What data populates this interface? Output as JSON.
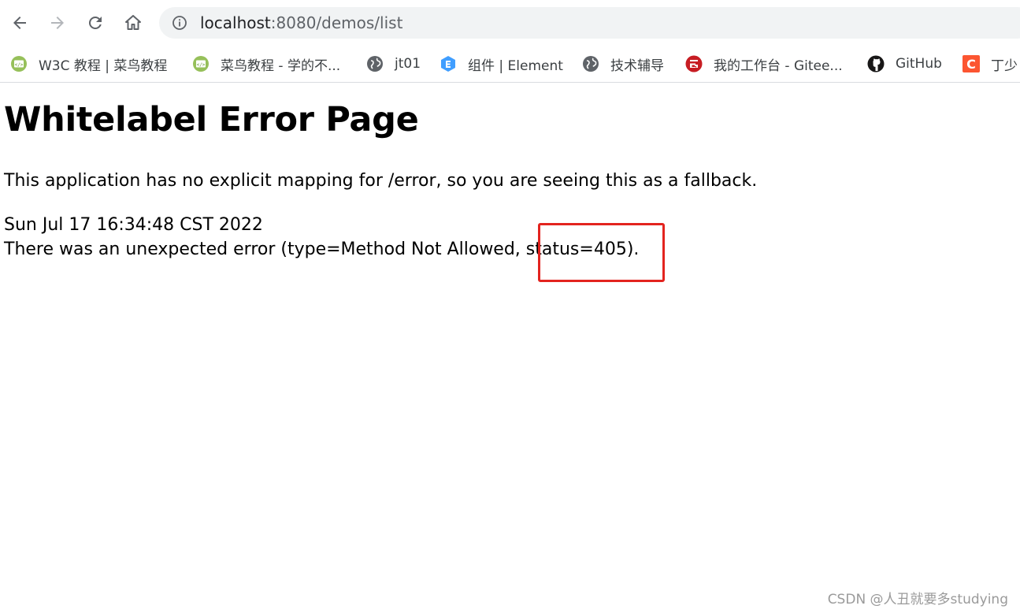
{
  "browser": {
    "address_bar": {
      "host": "localhost",
      "rest": ":8080/demos/list"
    },
    "icons": {
      "back": "arrow-left-icon",
      "forward": "arrow-right-icon",
      "reload": "reload-icon",
      "home": "home-icon",
      "site_info": "info-circle-icon"
    },
    "bookmarks": [
      {
        "label": "W3C 教程 | 菜鸟教程",
        "icon": "runoob-icon"
      },
      {
        "label": "菜鸟教程 - 学的不...",
        "icon": "runoob-icon"
      },
      {
        "label": "jt01",
        "icon": "globe-icon"
      },
      {
        "label": "组件 | Element",
        "icon": "element-icon"
      },
      {
        "label": "技术辅导",
        "icon": "globe-icon"
      },
      {
        "label": "我的工作台 - Gitee...",
        "icon": "gitee-icon"
      },
      {
        "label": "GitHub",
        "icon": "github-icon"
      },
      {
        "label": "丁少",
        "icon": "csdn-icon"
      }
    ]
  },
  "page": {
    "title": "Whitelabel Error Page",
    "description": "This application has no explicit mapping for /error, so you are seeing this as a fallback.",
    "timestamp": "Sun Jul 17 16:34:48 CST 2022",
    "error_line": "There was an unexpected error (type=Method Not Allowed, status=405)."
  },
  "annotation": {
    "color": "#e3241f"
  },
  "watermark": "CSDN @人丑就要多studying"
}
